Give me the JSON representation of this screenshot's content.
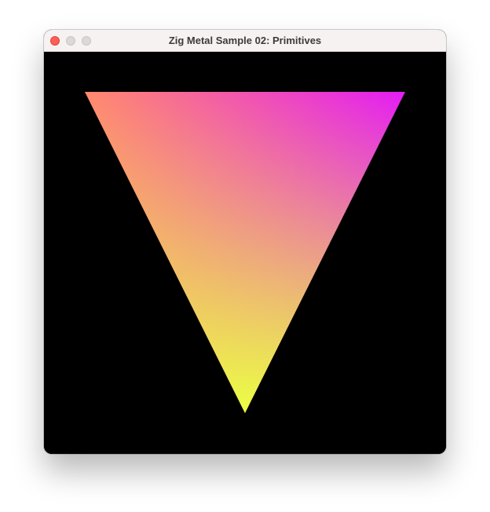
{
  "window": {
    "title": "Zig Metal Sample 02: Primitives",
    "buttons": [
      {
        "name": "close",
        "color": "#fe5f57",
        "border": "#e0443e"
      },
      {
        "name": "minimize",
        "color": "#dcd8d7",
        "border": "#c9c5c4"
      },
      {
        "name": "zoom",
        "color": "#dcd8d7",
        "border": "#c9c5c4"
      }
    ]
  },
  "canvas": {
    "background": "#000000",
    "shape": "triangle",
    "vertex_colors": {
      "top_left": "#ff8a6e",
      "top_right": "#e31cf5",
      "bottom": "#ecff44"
    }
  }
}
